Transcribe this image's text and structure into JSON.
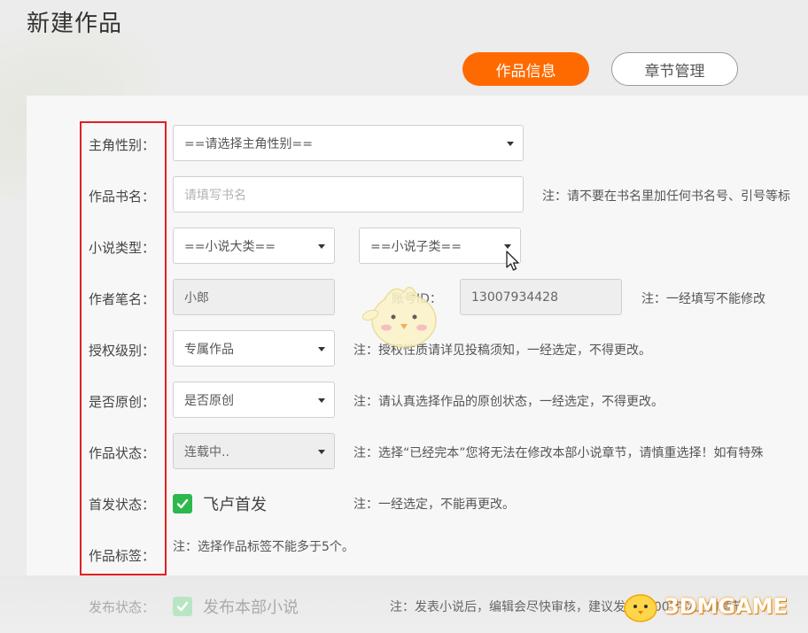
{
  "page": {
    "title": "新建作品"
  },
  "tabs": [
    {
      "label": "作品信息",
      "active": true
    },
    {
      "label": "章节管理",
      "active": false
    }
  ],
  "colors": {
    "accent": "#ff6a00",
    "check_green": "#2db84d",
    "highlight_frame": "#e02020"
  },
  "form": {
    "gender": {
      "label": "主角性别：",
      "value": "==请选择主角性别=="
    },
    "book_name": {
      "label": "作品书名：",
      "placeholder": "请填写书名",
      "note": "注：请不要在书名里加任何书名号、引号等标"
    },
    "novel_type": {
      "label": "小说类型：",
      "main_value": "==小说大类==",
      "sub_value": "==小说子类=="
    },
    "pen_name": {
      "label": "作者笔名：",
      "value": "小郎",
      "account_label": "账号ID：",
      "account_value": "13007934428",
      "note": "注：一经填写不能修改"
    },
    "license": {
      "label": "授权级别：",
      "value": "专属作品",
      "note": "注：授权性质请详见投稿须知，一经选定，不得更改。"
    },
    "original": {
      "label": "是否原创：",
      "value": "是否原创",
      "note": "注：请认真选择作品的原创状态，一经选定，不得更改。"
    },
    "status": {
      "label": "作品状态：",
      "value": "连载中..",
      "note": "注：选择“已经完本”您将无法在修改本部小说章节，请慎重选择！如有特殊"
    },
    "first_publish": {
      "label": "首发状态：",
      "checkbox_label": "飞卢首发",
      "checked": true,
      "note": "注：一经选定，不能再更改。"
    },
    "tags": {
      "label": "作品标签：",
      "note": "注：选择作品标签不能多于5个。"
    },
    "publish": {
      "label": "发布状态：",
      "checkbox_label": "发布本部小说",
      "checked": true,
      "note": "注：发表小说后，编辑会尽快审核，建议发布1000字以上的章节"
    }
  },
  "watermark": {
    "text": "3DMGAME"
  }
}
